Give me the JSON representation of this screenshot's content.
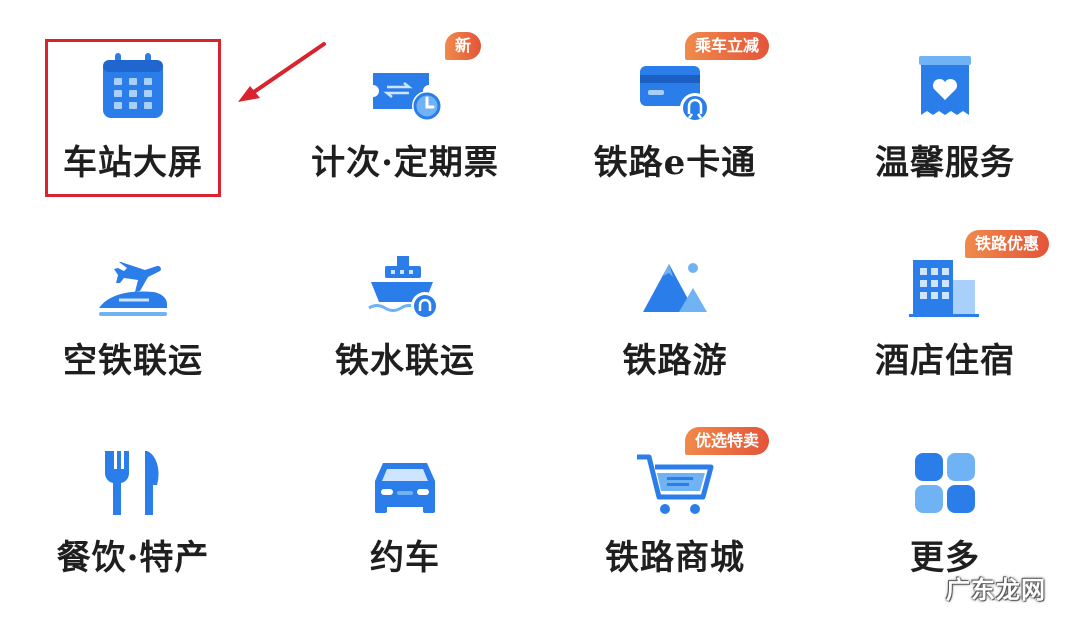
{
  "colors": {
    "icon_blue": "#2b7de9",
    "icon_light": "#6fb3f5",
    "badge": "#e4543a",
    "highlight": "#d9232d"
  },
  "grid": {
    "tiles": [
      {
        "label": "车站大屏",
        "icon": "calendar-icon",
        "badge": ""
      },
      {
        "label": "计次·定期票",
        "icon": "ticket-clock-icon",
        "badge": "新"
      },
      {
        "label": "铁路e卡通",
        "icon": "railway-card-icon",
        "badge": "乘车立减"
      },
      {
        "label": "温馨服务",
        "icon": "heart-bag-icon",
        "badge": ""
      },
      {
        "label": "空铁联运",
        "icon": "plane-train-icon",
        "badge": ""
      },
      {
        "label": "铁水联运",
        "icon": "ship-rail-icon",
        "badge": ""
      },
      {
        "label": "铁路游",
        "icon": "mountain-icon",
        "badge": ""
      },
      {
        "label": "酒店住宿",
        "icon": "hotel-building-icon",
        "badge": "铁路优惠"
      },
      {
        "label": "餐饮·特产",
        "icon": "fork-knife-icon",
        "badge": ""
      },
      {
        "label": "约车",
        "icon": "car-icon",
        "badge": ""
      },
      {
        "label": "铁路商城",
        "icon": "shopping-cart-icon",
        "badge": "优选特卖"
      },
      {
        "label": "更多",
        "icon": "grid-more-icon",
        "badge": ""
      }
    ]
  },
  "watermark": "广东龙网"
}
